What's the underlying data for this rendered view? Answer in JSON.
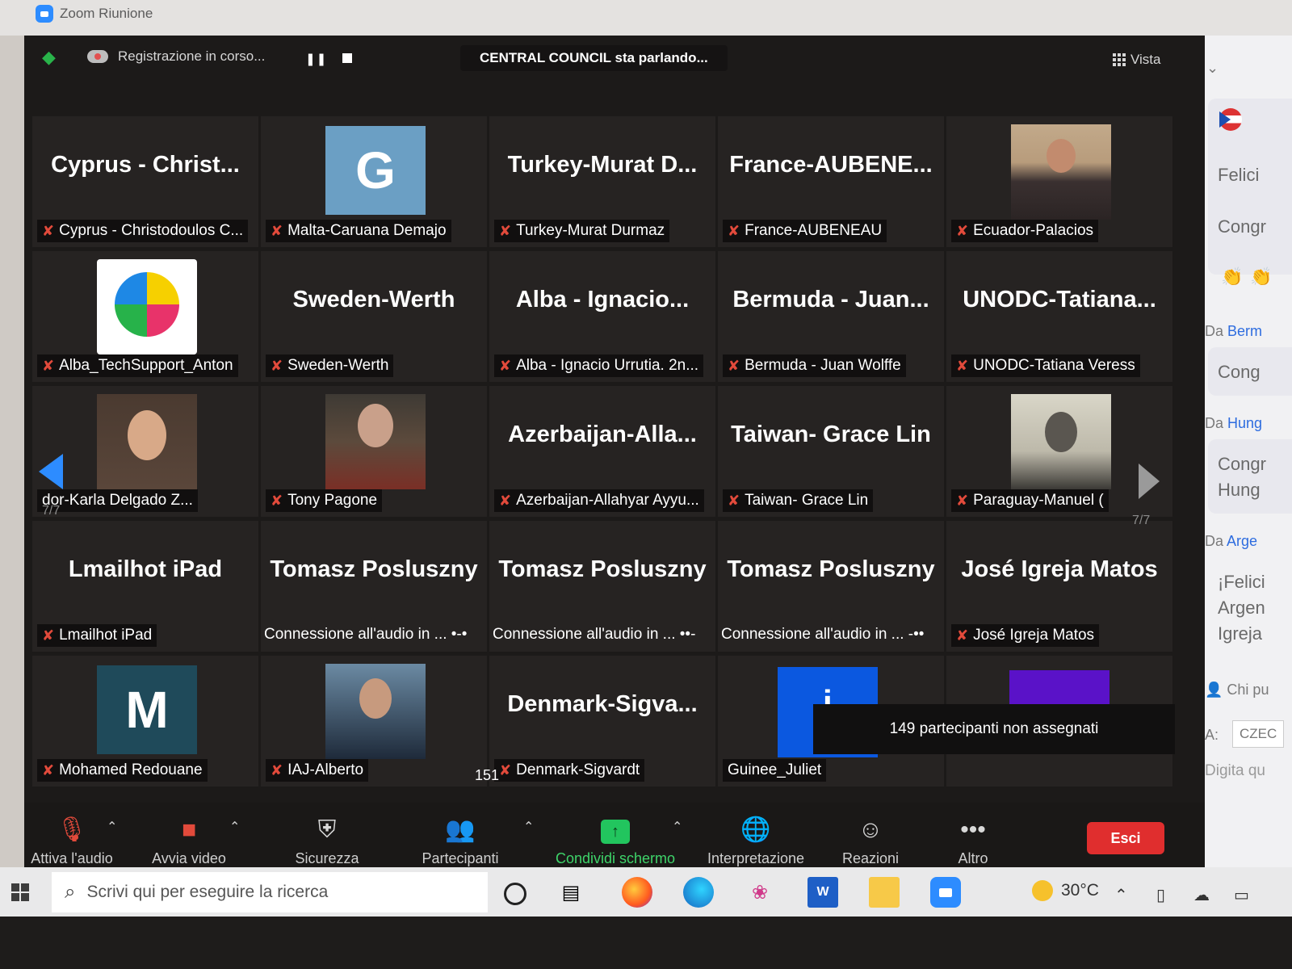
{
  "window": {
    "app_title": "Zoom Riunione"
  },
  "topbar": {
    "recording_text": "Registrazione in corso...",
    "speaking_text": "CENTRAL COUNCIL sta parlando...",
    "view_label": "Vista",
    "pause_symbol": "❚❚"
  },
  "tiles": [
    {
      "big": "Cyprus  -  Christ...",
      "label": "Cyprus - Christodoulos C...",
      "muted": true,
      "kind": "name"
    },
    {
      "avatar_letter": "G",
      "avatar_color": "#6b9fc4",
      "label": "Malta-Caruana Demajo",
      "muted": true,
      "kind": "avatar"
    },
    {
      "big": "Turkey-Murat  D...",
      "label": "Turkey-Murat Durmaz",
      "muted": true,
      "kind": "name"
    },
    {
      "big": "France-AUBENE...",
      "label": "France-AUBENEAU",
      "muted": true,
      "kind": "name"
    },
    {
      "label": "Ecuador-Palacios",
      "muted": true,
      "kind": "photo",
      "photo": "suit"
    },
    {
      "label": "Alba_TechSupport_Anton",
      "muted": true,
      "kind": "photo",
      "photo": "logo"
    },
    {
      "big": "Sweden-Werth",
      "label": "Sweden-Werth",
      "muted": true,
      "kind": "name"
    },
    {
      "big": "Alba  -  Ignacio...",
      "label": "Alba - Ignacio Urrutia. 2n...",
      "muted": true,
      "kind": "name"
    },
    {
      "big": "Bermuda  -  Juan...",
      "label": "Bermuda - Juan Wolffe",
      "muted": true,
      "kind": "name"
    },
    {
      "big": "UNODC-Tatiana...",
      "label": "UNODC-Tatiana Veress",
      "muted": true,
      "kind": "name"
    },
    {
      "label": "dor-Karla Delgado Z...",
      "muted": false,
      "kind": "photo",
      "photo": "woman"
    },
    {
      "label": "Tony Pagone",
      "muted": true,
      "kind": "photo",
      "photo": "old"
    },
    {
      "big": "Azerbaijan-Alla...",
      "label": "Azerbaijan-Allahyar Ayyu...",
      "muted": true,
      "kind": "name"
    },
    {
      "big": "Taiwan- Grace Lin",
      "label": "Taiwan- Grace Lin",
      "muted": true,
      "kind": "name"
    },
    {
      "label": "Paraguay-Manuel (",
      "muted": true,
      "kind": "photo",
      "photo": "bw"
    },
    {
      "big": "Lmailhot iPad",
      "label": "Lmailhot iPad",
      "muted": true,
      "kind": "name"
    },
    {
      "big": "Tomasz Posluszny",
      "connecting": "Connessione all'audio in ...  •-•",
      "kind": "connecting"
    },
    {
      "big": "Tomasz Posluszny",
      "connecting": "Connessione all'audio in ...  ••-",
      "kind": "connecting"
    },
    {
      "big": "Tomasz Posluszny",
      "connecting": "Connessione all'audio in ...  -••",
      "kind": "connecting"
    },
    {
      "big": "José Igreja Matos",
      "label": "José Igreja Matos",
      "muted": true,
      "kind": "name"
    },
    {
      "avatar_letter": "M",
      "avatar_color": "#1f4a5a",
      "label": "Mohamed Redouane",
      "muted": true,
      "kind": "avatar"
    },
    {
      "label": "IAJ-Alberto",
      "muted": true,
      "kind": "photo",
      "photo": "man"
    },
    {
      "big": "Denmark-Sigva...",
      "label": "Denmark-Sigvardt",
      "muted": true,
      "kind": "name"
    },
    {
      "label": "Guinee_Juliet",
      "muted": false,
      "kind": "blue"
    },
    {
      "kind": "purple"
    }
  ],
  "pagination": {
    "left": "7/7",
    "right": "7/7"
  },
  "unassigned": "149 partecipanti non assegnati",
  "toolbar": {
    "audio": "Attiva l'audio",
    "video": "Avvia video",
    "security": "Sicurezza",
    "participants": "Partecipanti",
    "participants_count": "151",
    "share": "Condividi schermo",
    "interpretation": "Interpretazione",
    "reactions": "Reazioni",
    "more": "Altro",
    "leave": "Esci"
  },
  "chat": {
    "msg1a": "Felici",
    "msg1b": "Congr",
    "from1_prefix": "Da",
    "from1_name": "Berm",
    "msg2": "Cong",
    "from2_prefix": "Da",
    "from2_name": "Hung",
    "msg3a": "Congr",
    "msg3b": "Hung",
    "from3_prefix": "Da",
    "from3_name": "Arge",
    "msg4a": "¡Felici",
    "msg4b": "Argen",
    "msg4c": "Igreja",
    "who": "Chi pu",
    "to_label": "A:",
    "to_value": "CZEC",
    "input_placeholder": "Digita qu"
  },
  "taskbar": {
    "search_placeholder": "Scrivi qui per eseguire la ricerca",
    "temperature": "30°C"
  }
}
